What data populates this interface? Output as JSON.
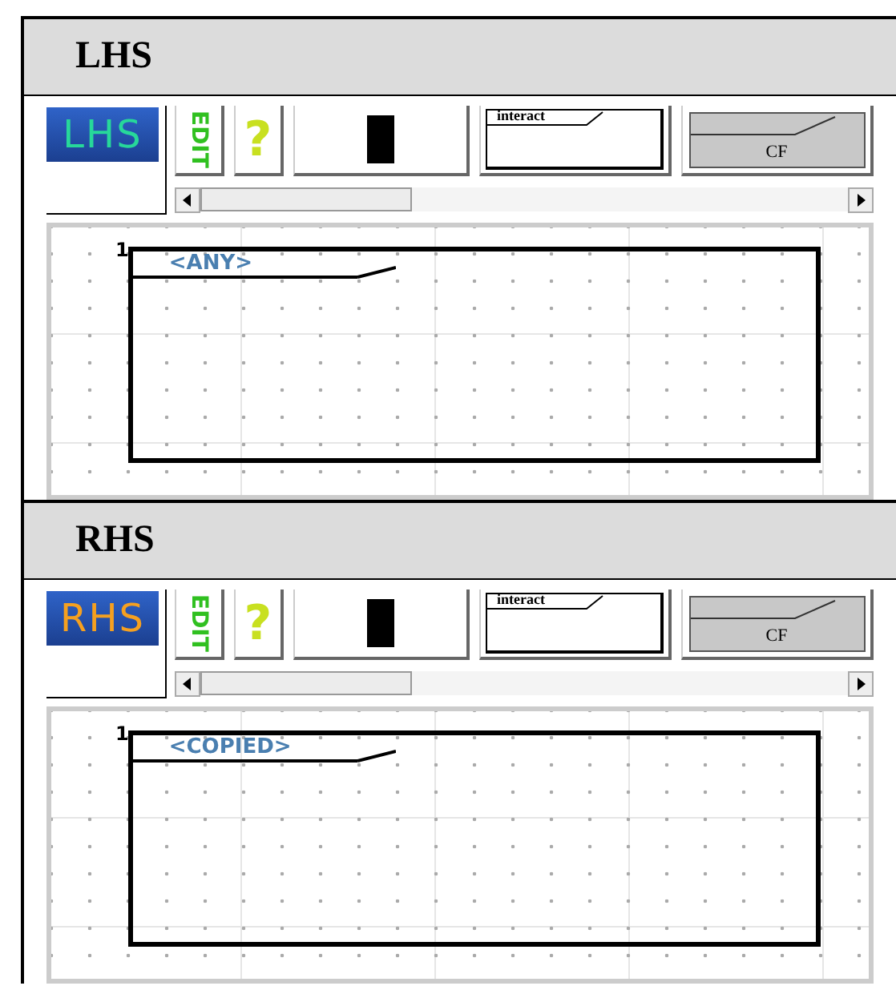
{
  "sections": [
    {
      "heading": "LHS",
      "badge": {
        "label": "LHS",
        "kind": "lhs"
      },
      "edit_label": "EDIT",
      "help_label": "?",
      "interact_label": "interact",
      "cf_label": "CF",
      "rule_number": "1",
      "pattern_label": "<ANY>"
    },
    {
      "heading": "RHS",
      "badge": {
        "label": "RHS",
        "kind": "rhs"
      },
      "edit_label": "EDIT",
      "help_label": "?",
      "interact_label": "interact",
      "cf_label": "CF",
      "rule_number": "1",
      "pattern_label": "<COPIED>"
    }
  ]
}
